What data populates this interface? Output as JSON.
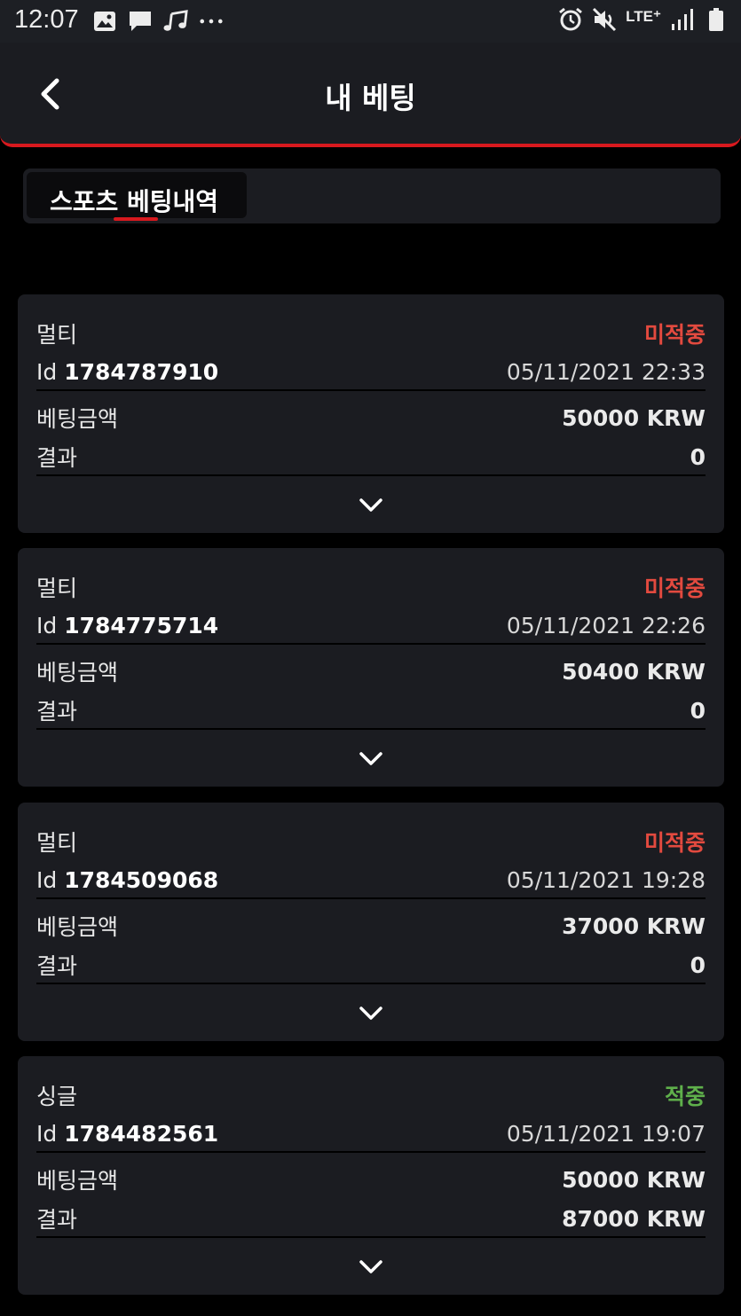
{
  "status_bar": {
    "time": "12:07",
    "network": "LTE⁺",
    "left_icons": [
      "image-icon",
      "message-icon",
      "music-note-icon",
      "more-dots-icon"
    ],
    "right_icons": [
      "alarm-icon",
      "mute-icon",
      "signal-icon",
      "battery-icon"
    ]
  },
  "header": {
    "title": "내 베팅",
    "accent_color": "#d8191e"
  },
  "tabs": [
    {
      "label": "스포츠 베팅내역",
      "active": true
    }
  ],
  "bets": [
    {
      "type": "멀티",
      "status": "미적중",
      "id_label": "Id",
      "id": "1784787910",
      "datetime": "05/11/2021 22:33",
      "amount_label": "베팅금액",
      "amount": "50000 KRW",
      "result_label": "결과",
      "result": "0"
    },
    {
      "type": "멀티",
      "status": "미적중",
      "id_label": "Id",
      "id": "1784775714",
      "datetime": "05/11/2021 22:26",
      "amount_label": "베팅금액",
      "amount": "50400 KRW",
      "result_label": "결과",
      "result": "0"
    },
    {
      "type": "멀티",
      "status": "미적중",
      "id_label": "Id",
      "id": "1784509068",
      "datetime": "05/11/2021 19:28",
      "amount_label": "베팅금액",
      "amount": "37000 KRW",
      "result_label": "결과",
      "result": "0"
    },
    {
      "type": "싱글",
      "status": "적중",
      "id_label": "Id",
      "id": "1784482561",
      "datetime": "05/11/2021 19:07",
      "amount_label": "베팅금액",
      "amount": "50000 KRW",
      "result_label": "결과",
      "result": "87000 KRW"
    }
  ],
  "colors": {
    "status_pending": "#e34a3f",
    "status_win": "#5fb04b",
    "card_background": "#1b1c21",
    "page_background": "#000000"
  }
}
